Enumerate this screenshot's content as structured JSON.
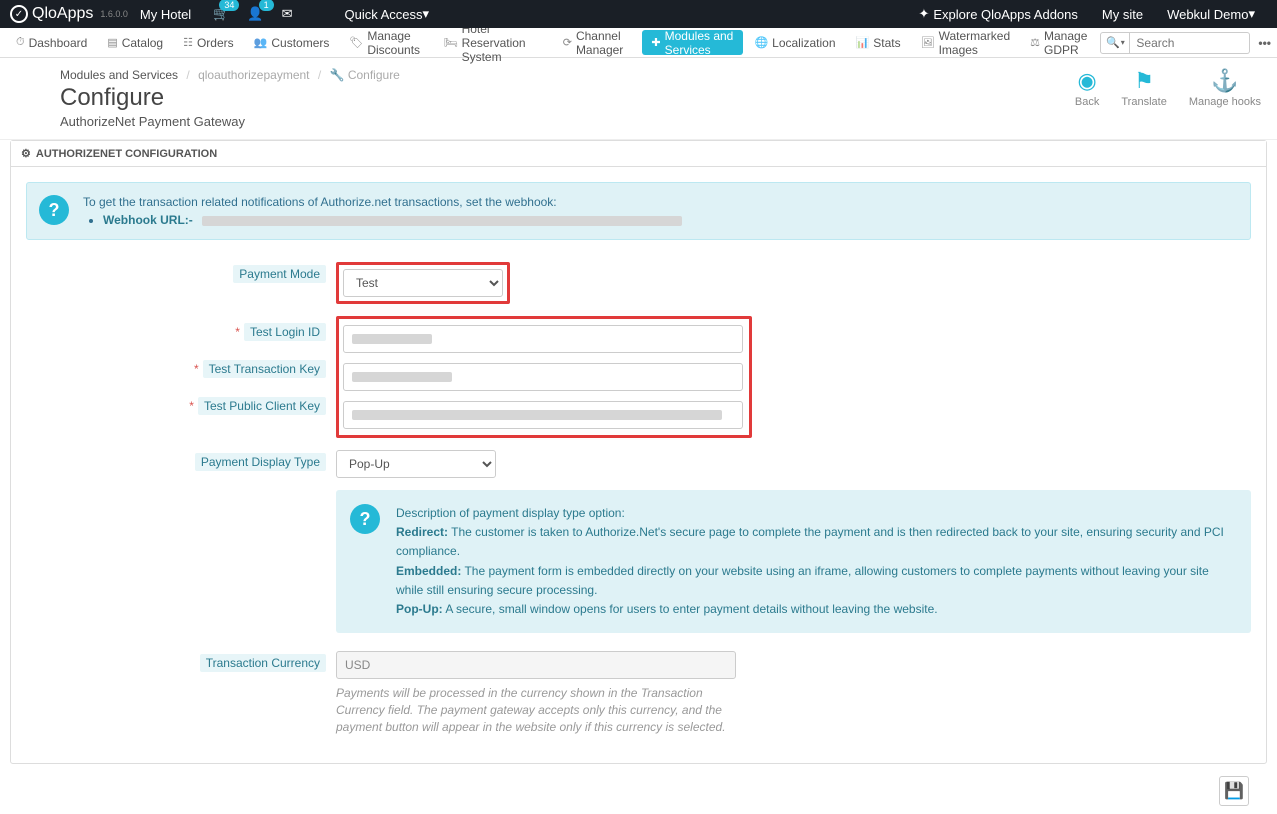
{
  "top": {
    "brand": "QloApps",
    "version": "1.6.0.0",
    "hotel": "My Hotel",
    "cart_badge": "34",
    "user_badge": "1",
    "quick_access": "Quick Access",
    "addons": "Explore QloApps Addons",
    "mysite": "My site",
    "user": "Webkul Demo"
  },
  "nav": {
    "dashboard": "Dashboard",
    "catalog": "Catalog",
    "orders": "Orders",
    "customers": "Customers",
    "discounts": "Manage Discounts",
    "hrs": "Hotel Reservation System",
    "channel": "Channel Manager",
    "modules": "Modules and Services",
    "localization": "Localization",
    "stats": "Stats",
    "watermark": "Watermarked Images",
    "gdpr": "Manage GDPR",
    "search_placeholder": "Search",
    "more": "•••"
  },
  "header": {
    "crumb1": "Modules and Services",
    "crumb2": "qloauthorizepayment",
    "crumb3": "Configure",
    "title": "Configure",
    "subtitle": "AuthorizeNet Payment Gateway",
    "back": "Back",
    "translate": "Translate",
    "hooks": "Manage hooks"
  },
  "panel": {
    "heading": "AUTHORIZENET CONFIGURATION",
    "alert_text": "To get the transaction related notifications of Authorize.net transactions, set the webhook:",
    "webhook_label": "Webhook URL:-"
  },
  "form": {
    "payment_mode_label": "Payment Mode",
    "payment_mode_value": "Test",
    "login_id_label": "Test Login ID",
    "txn_key_label": "Test Transaction Key",
    "pub_key_label": "Test Public Client Key",
    "display_label": "Payment Display Type",
    "display_value": "Pop-Up",
    "currency_label": "Transaction Currency",
    "currency_value": "USD",
    "currency_help": "Payments will be processed in the currency shown in the Transaction Currency field. The payment gateway accepts only this currency, and the payment button will appear in the website only if this currency is selected."
  },
  "desc": {
    "intro": "Description of payment display type option:",
    "redirect_k": "Redirect:",
    "redirect_v": " The customer is taken to Authorize.Net's secure page to complete the payment and is then redirected back to your site, ensuring security and PCI compliance.",
    "embedded_k": "Embedded:",
    "embedded_v": " The payment form is embedded directly on your website using an iframe, allowing customers to complete payments without leaving your site while still ensuring secure processing.",
    "popup_k": "Pop-Up:",
    "popup_v": " A secure, small window opens for users to enter payment details without leaving the website."
  }
}
